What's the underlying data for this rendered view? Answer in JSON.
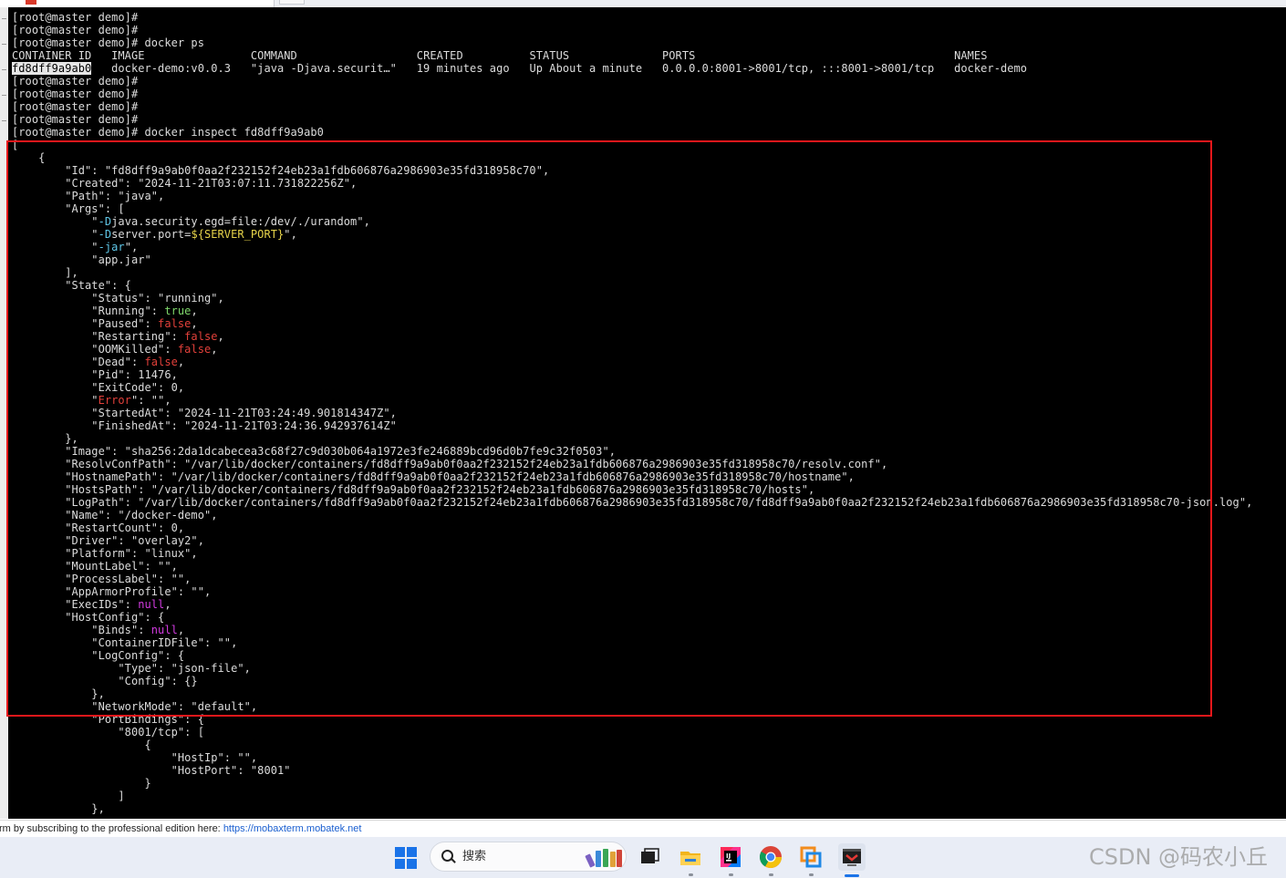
{
  "terminal": {
    "prompt": "[root@master demo]#",
    "cmd_ps": "[root@master demo]# docker ps",
    "ps_headers": [
      "CONTAINER ID",
      "IMAGE",
      "COMMAND",
      "CREATED",
      "STATUS",
      "PORTS",
      "NAMES"
    ],
    "ps_row": [
      "fd8dff9a9ab0",
      "docker-demo:v0.0.3",
      "\"java -Djava.securit…\"",
      "19 minutes ago",
      "Up About a minute",
      "0.0.0.0:8001->8001/tcp, :::8001->8001/tcp",
      "docker-demo"
    ],
    "cmd_inspect": "[root@master demo]# docker inspect fd8dff9a9ab0",
    "inspect": {
      "Id": "fd8dff9a9ab0f0aa2f232152f24eb23a1fdb606876a2986903e35fd318958c70",
      "Created": "2024-11-21T03:07:11.731822256Z",
      "Path": "java",
      "Args": [
        "-Djava.security.egd=file:/dev/./urandom",
        "-Dserver.port=${SERVER_PORT}",
        "-jar",
        "app.jar"
      ],
      "State": {
        "Status": "running",
        "Running": "true",
        "Paused": "false",
        "Restarting": "false",
        "OOMKilled": "false",
        "Dead": "false",
        "Pid": "11476",
        "ExitCode": "0",
        "Error": "",
        "StartedAt": "2024-11-21T03:24:49.901814347Z",
        "FinishedAt": "2024-11-21T03:24:36.942937614Z"
      },
      "Image": "sha256:2da1dcabecea3c68f27c9d030b064a1972e3fe246889bcd96d0b7fe9c32f0503",
      "ResolvConfPath": "/var/lib/docker/containers/fd8dff9a9ab0f0aa2f232152f24eb23a1fdb606876a2986903e35fd318958c70/resolv.conf",
      "HostnamePath": "/var/lib/docker/containers/fd8dff9a9ab0f0aa2f232152f24eb23a1fdb606876a2986903e35fd318958c70/hostname",
      "HostsPath": "/var/lib/docker/containers/fd8dff9a9ab0f0aa2f232152f24eb23a1fdb606876a2986903e35fd318958c70/hosts",
      "LogPath": "/var/lib/docker/containers/fd8dff9a9ab0f0aa2f232152f24eb23a1fdb606876a2986903e35fd318958c70/fd8dff9a9ab0f0aa2f232152f24eb23a1fdb606876a2986903e35fd318958c70-json.log",
      "Name": "/docker-demo",
      "RestartCount": "0",
      "Driver": "overlay2",
      "Platform": "linux",
      "MountLabel": "",
      "ProcessLabel": "",
      "AppArmorProfile": "",
      "ExecIDs": "null",
      "HostConfig": {
        "Binds": "null",
        "ContainerIDFile": "",
        "LogConfig": {
          "Type": "json-file",
          "Config": "{}"
        },
        "NetworkMode": "default",
        "PortBindingsKey": "8001/tcp",
        "HostIp": "",
        "HostPort": "8001"
      }
    }
  },
  "statusbar": {
    "message": "rm by subscribing to the professional edition here:",
    "link": "https://mobaxterm.mobatek.net"
  },
  "taskbar": {
    "search_placeholder": "搜索"
  },
  "watermark": "CSDN @码农小丘",
  "colors": {
    "terminal_bg": "#000000",
    "text": "#dcdcdc",
    "boolean_true": "#7fd86b",
    "boolean_false": "#e2403a",
    "null": "#d23be0",
    "variable": "#e6d34a",
    "flag": "#5fc7e8",
    "highlight_box": "#e8171b"
  }
}
